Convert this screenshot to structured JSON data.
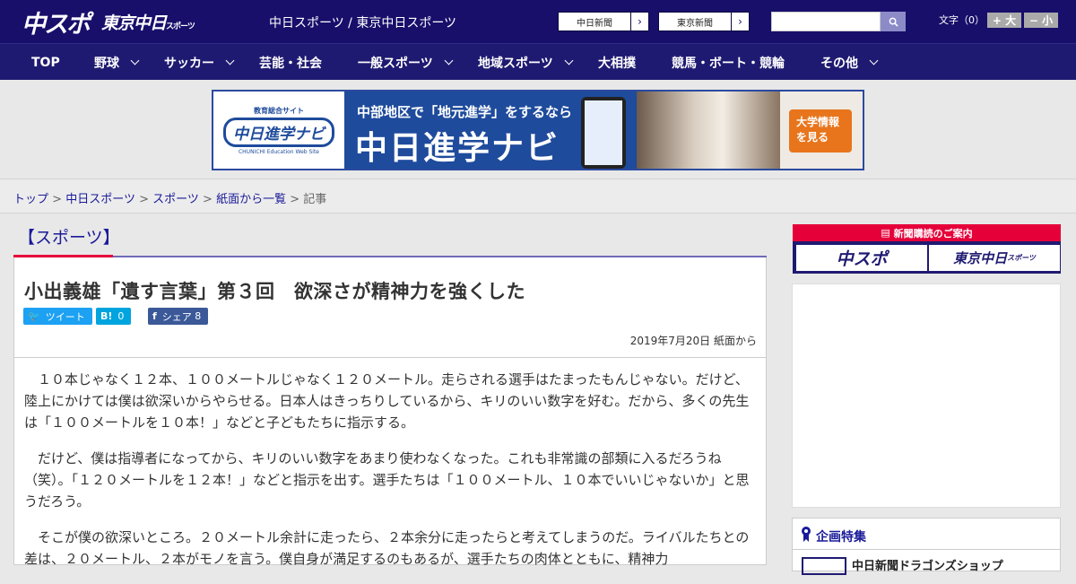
{
  "header": {
    "logo_main": "中スポ",
    "logo_tokyo": "東京中日",
    "logo_tokyo_small": "スポーツ",
    "site_title": "中日スポーツ / 東京中日スポーツ",
    "links": [
      {
        "label": "中日新聞"
      },
      {
        "label": "東京新聞"
      }
    ],
    "search": {
      "placeholder": "",
      "value": ""
    },
    "font_size_label": "文字（0）",
    "font_larger": "+ 大",
    "font_smaller": "− 小"
  },
  "nav": {
    "items": [
      {
        "label": "TOP"
      },
      {
        "label": "野球"
      },
      {
        "label": "サッカー"
      },
      {
        "label": "芸能・社会"
      },
      {
        "label": "一般スポーツ"
      },
      {
        "label": "地域スポーツ"
      },
      {
        "label": "大相撲"
      },
      {
        "label": "競馬・ボート・競輪"
      },
      {
        "label": "その他"
      }
    ]
  },
  "banner": {
    "logo_top": "教育総合サイト",
    "logo_name": "中日進学ナビ",
    "logo_en": "CHUNICHI Education Web Site",
    "sub": "中部地区で「地元進学」をするなら",
    "main": "中日進学ナビ",
    "cta": "大学情報を見る"
  },
  "breadcrumb": {
    "items": [
      "トップ",
      "中日スポーツ",
      "スポーツ",
      "紙面から一覧"
    ],
    "current": "記事",
    "separator": ">"
  },
  "article": {
    "category": "【スポーツ】",
    "headline": "小出義雄「遺す言葉」第３回　欲深さが精神力を強くした",
    "tweet_label": "ツイート",
    "hatena_icon": "B!",
    "hatena_count": "0",
    "share_label": "シェア",
    "share_count": "8",
    "date": "2019年7月20日 紙面から",
    "paragraphs": [
      "１０本じゃなく１２本、１００メートルじゃなく１２０メートル。走らされる選手はたまったもんじゃない。だけど、陸上にかけては僕は欲深いからやらせる。日本人はきっちりしているから、キリのいい数字を好む。だから、多くの先生は「１００メートルを１０本！」などと子どもたちに指示する。",
      "だけど、僕は指導者になってから、キリのいい数字をあまり使わなくなった。これも非常識の部類に入るだろうね（笑）。「１２０メートルを１２本！」などと指示を出す。選手たちは「１００メートル、１０本でいいじゃないか」と思うだろう。",
      "そこが僕の欲深いところ。２０メートル余計に走ったら、２本余分に走ったらと考えてしまうのだ。ライバルたちとの差は、２０メートル、２本がモノを言う。僕自身が満足するのもあるが、選手たちの肉体とともに、精神力"
    ]
  },
  "sidebar": {
    "subscribe_title": "新聞購読のご案内",
    "sub_chuspo": "中スポ",
    "sub_tokyo": "東京中日",
    "sub_tokyo_small": "スポーツ",
    "feature_title": "企画特集",
    "feature_item": "中日新聞ドラゴンズショップ"
  },
  "colors": {
    "header_bg": "#180f6b",
    "nav_bg": "#1f1a71",
    "accent_red": "#e5003a",
    "link_blue": "#1a1a99"
  }
}
